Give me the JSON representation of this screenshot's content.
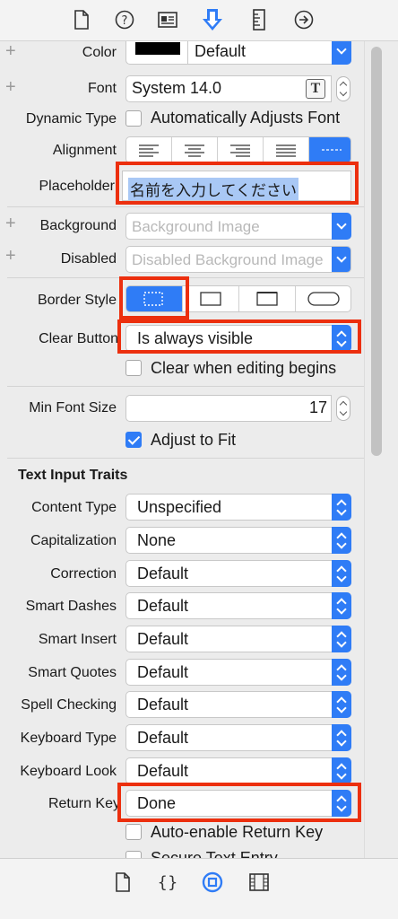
{
  "toolbar_icons": [
    "file-inspector-icon",
    "help-inspector-icon",
    "identity-inspector-icon",
    "attributes-inspector-icon",
    "size-inspector-icon",
    "connections-inspector-icon"
  ],
  "attrs": {
    "color": {
      "label": "Color",
      "value": "Default",
      "swatch": "#000000"
    },
    "font": {
      "label": "Font",
      "value": "System 14.0"
    },
    "dynamic_type": {
      "label": "Dynamic Type",
      "checkbox_label": "Automatically Adjusts Font"
    },
    "alignment": {
      "label": "Alignment"
    },
    "placeholder": {
      "label": "Placeholder",
      "value": "名前を入力してください"
    },
    "background": {
      "label": "Background",
      "placeholder": "Background Image"
    },
    "disabled": {
      "label": "Disabled",
      "placeholder": "Disabled Background Image"
    },
    "border_style": {
      "label": "Border Style"
    },
    "clear_button": {
      "label": "Clear Button",
      "value": "Is always visible",
      "checkbox_label": "Clear when editing begins"
    },
    "min_font_size": {
      "label": "Min Font Size",
      "value": "17"
    },
    "adjust_to_fit": {
      "label": "Adjust to Fit",
      "checked": true
    }
  },
  "text_input_traits": {
    "title": "Text Input Traits",
    "rows": [
      {
        "label": "Content Type",
        "value": "Unspecified"
      },
      {
        "label": "Capitalization",
        "value": "None"
      },
      {
        "label": "Correction",
        "value": "Default"
      },
      {
        "label": "Smart Dashes",
        "value": "Default"
      },
      {
        "label": "Smart Insert",
        "value": "Default"
      },
      {
        "label": "Smart Quotes",
        "value": "Default"
      },
      {
        "label": "Spell Checking",
        "value": "Default"
      },
      {
        "label": "Keyboard Type",
        "value": "Default"
      },
      {
        "label": "Keyboard Look",
        "value": "Default"
      },
      {
        "label": "Return Key",
        "value": "Done"
      }
    ],
    "auto_enable_label": "Auto-enable Return Key",
    "secure_entry_label": "Secure Text Entry"
  },
  "bottom_icons": [
    "file-template-icon",
    "code-snippet-icon",
    "object-library-icon",
    "media-library-icon"
  ],
  "colors": {
    "accent": "#2f7cf6",
    "highlight": "#ec2f0e"
  }
}
